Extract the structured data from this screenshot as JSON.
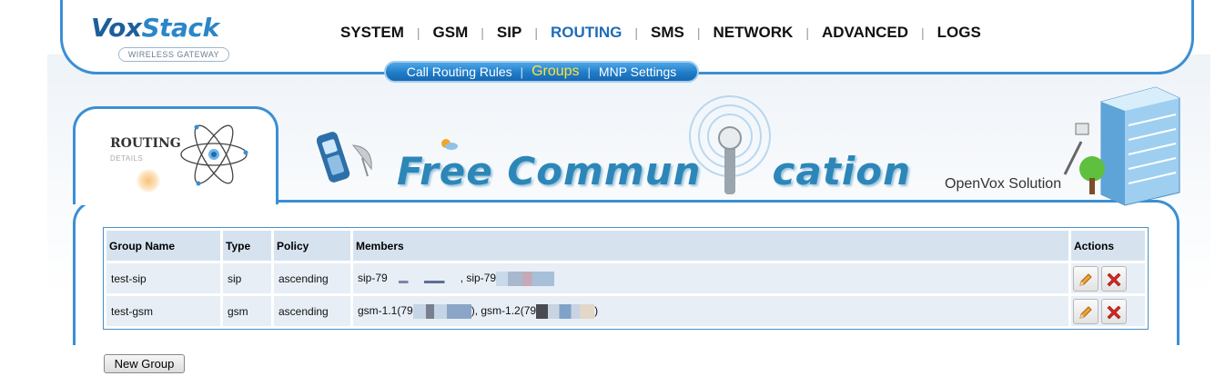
{
  "brand": {
    "logo_vox": "Vox",
    "logo_stack": "Stack",
    "logo_sub": "WIRELESS GATEWAY"
  },
  "nav": {
    "items": [
      "SYSTEM",
      "GSM",
      "SIP",
      "ROUTING",
      "SMS",
      "NETWORK",
      "ADVANCED",
      "LOGS"
    ],
    "active": "ROUTING"
  },
  "subnav": {
    "items": [
      "Call Routing Rules",
      "Groups",
      "MNP Settings"
    ],
    "active": "Groups"
  },
  "section": {
    "title": "ROUTING",
    "subtitle": "DETAILS"
  },
  "banner": {
    "text_left": "Free Commun",
    "text_right": "cation",
    "openvox": "OpenVox Solution"
  },
  "table": {
    "headers": [
      "Group Name",
      "Type",
      "Policy",
      "Members",
      "Actions"
    ],
    "rows": [
      {
        "name": "test-sip",
        "type": "sip",
        "policy": "ascending",
        "members_a": "sip-79",
        "members_b": ", sip-79",
        "members_c": ""
      },
      {
        "name": "test-gsm",
        "type": "gsm",
        "policy": "ascending",
        "members_a": "gsm-1.1(79",
        "members_b": "), gsm-1.2(79",
        "members_c": ")"
      }
    ]
  },
  "actions": {
    "edit_icon": "pencil-icon",
    "delete_icon": "red-x-icon"
  },
  "buttons": {
    "new_group": "New Group"
  },
  "colors": {
    "accent": "#3b8fd4",
    "brand_dark": "#1d5f9a",
    "active_nav": "#1e6cb8",
    "active_sub": "#ffe23d",
    "header_cell": "#d6e3ef",
    "row_cell": "#e7eef6"
  }
}
